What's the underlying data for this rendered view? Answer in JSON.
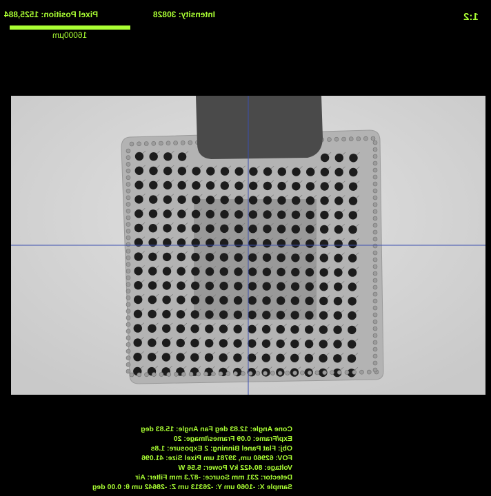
{
  "header": {
    "pixel_position": "Pixel Position: 1525,884",
    "intensity": "Intensity: 30828",
    "zoom": "1:2",
    "scale_label": "16000µm"
  },
  "image_view": {
    "subject": "ball-grid-array-package-xray",
    "crosshair_color": "#3b4fb0",
    "background_color": "#d9d9d9"
  },
  "info_panel": {
    "lines": [
      "Cone Angle:  12.83 deg            Fan Angle: 15.83 deg",
      "Exp/Frame:  0.09    Frames/Image:  20",
      "Obj:  Flat Panel  Binning:  2      Exposure:  1.8s",
      "FOV:  62960 um, 39781 um   Pixel Size: 41.096",
      "Voltage:  80.422 kV    Power:  5.56 W",
      "Detector:   231 mm     Source:  -87.3 mm   Filter:  Air",
      "Sample X:  -1060 um   Y:  -26313 um  Z:  -28642 um  θ: 0.00 deg"
    ]
  },
  "colors": {
    "overlay": "#aaff33",
    "background": "#000000"
  }
}
